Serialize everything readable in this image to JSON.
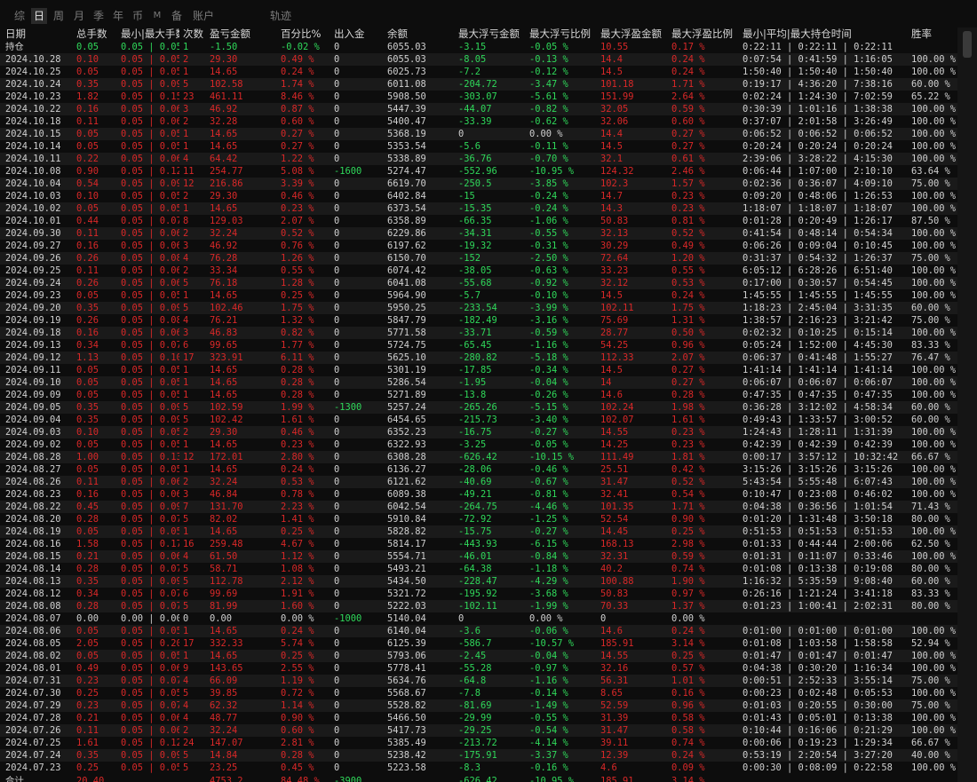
{
  "tabs": [
    "综",
    "日",
    "周",
    "月",
    "季",
    "年",
    "币",
    "M",
    "备",
    "账户",
    "轨迹"
  ],
  "active_tab": "日",
  "headers": [
    "日期",
    "总手数",
    "最小|最大手数",
    "次数",
    "盈亏金额",
    "百分比%",
    "出入金",
    "余额",
    "最大浮亏金额",
    "最大浮亏比例",
    "最大浮盈金额",
    "最大浮盈比例",
    "最小|平均|最大持仓时间",
    "胜率"
  ],
  "holding_row": {
    "label": "持仓",
    "lots": "0.05",
    "minmax": "0.05 | 0.05",
    "count": "1",
    "pnl": "-1.50",
    "pct": "-0.02 %",
    "flow": "0",
    "balance": "6055.03",
    "max_dd": "-3.15",
    "max_dd_pct": "-0.05 %",
    "max_fp": "10.55",
    "max_fp_pct": "0.17 %",
    "hold": "0:22:11 | 0:22:11 | 0:22:11",
    "win": ""
  },
  "rows": [
    [
      "2024.10.28",
      "0.10",
      "0.05 | 0.05",
      "2",
      "29.30",
      "0.49 %",
      "0",
      "6055.03",
      "-8.05",
      "-0.13 %",
      "14.4",
      "0.24 %",
      "0:07:54 | 0:41:59 | 1:16:05",
      "100.00 %"
    ],
    [
      "2024.10.25",
      "0.05",
      "0.05 | 0.05",
      "1",
      "14.65",
      "0.24 %",
      "0",
      "6025.73",
      "-7.2",
      "-0.12 %",
      "14.5",
      "0.24 %",
      "1:50:40 | 1:50:40 | 1:50:40",
      "100.00 %"
    ],
    [
      "2024.10.24",
      "0.35",
      "0.05 | 0.09",
      "5",
      "102.58",
      "1.74 %",
      "0",
      "6011.08",
      "-204.72",
      "-3.47 %",
      "101.18",
      "1.71 %",
      "0:19:17 | 4:36:20 | 7:38:16",
      "60.00 %"
    ],
    [
      "2024.10.23",
      "1.82",
      "0.05 | 0.15",
      "23",
      "461.11",
      "8.46 %",
      "0",
      "5908.50",
      "-303.07",
      "-5.61 %",
      "151.99",
      "2.64 %",
      "0:02:24 | 1:24:30 | 7:02:59",
      "65.22 %"
    ],
    [
      "2024.10.22",
      "0.16",
      "0.05 | 0.06",
      "3",
      "46.92",
      "0.87 %",
      "0",
      "5447.39",
      "-44.07",
      "-0.82 %",
      "32.05",
      "0.59 %",
      "0:30:39 | 1:01:16 | 1:38:38",
      "100.00 %"
    ],
    [
      "2024.10.18",
      "0.11",
      "0.05 | 0.06",
      "2",
      "32.28",
      "0.60 %",
      "0",
      "5400.47",
      "-33.39",
      "-0.62 %",
      "32.06",
      "0.60 %",
      "0:37:07 | 2:01:58 | 3:26:49",
      "100.00 %"
    ],
    [
      "2024.10.15",
      "0.05",
      "0.05 | 0.05",
      "1",
      "14.65",
      "0.27 %",
      "0",
      "5368.19",
      "0",
      "0.00 %",
      "14.4",
      "0.27 %",
      "0:06:52 | 0:06:52 | 0:06:52",
      "100.00 %"
    ],
    [
      "2024.10.14",
      "0.05",
      "0.05 | 0.05",
      "1",
      "14.65",
      "0.27 %",
      "0",
      "5353.54",
      "-5.6",
      "-0.11 %",
      "14.5",
      "0.27 %",
      "0:20:24 | 0:20:24 | 0:20:24",
      "100.00 %"
    ],
    [
      "2024.10.11",
      "0.22",
      "0.05 | 0.06",
      "4",
      "64.42",
      "1.22 %",
      "0",
      "5338.89",
      "-36.76",
      "-0.70 %",
      "32.1",
      "0.61 %",
      "2:39:06 | 3:28:22 | 4:15:30",
      "100.00 %"
    ],
    [
      "2024.10.08",
      "0.90",
      "0.05 | 0.12",
      "11",
      "254.77",
      "5.08 %",
      "-1600",
      "5274.47",
      "-552.96",
      "-10.95 %",
      "124.32",
      "2.46 %",
      "0:06:44 | 1:07:00 | 2:10:10",
      "63.64 %"
    ],
    [
      "2024.10.04",
      "0.54",
      "0.05 | 0.09",
      "12",
      "216.86",
      "3.39 %",
      "0",
      "6619.70",
      "-250.5",
      "-3.85 %",
      "102.3",
      "1.57 %",
      "0:02:36 | 0:36:07 | 4:09:10",
      "75.00 %"
    ],
    [
      "2024.10.03",
      "0.10",
      "0.05 | 0.05",
      "2",
      "29.30",
      "0.46 %",
      "0",
      "6402.84",
      "-15",
      "-0.24 %",
      "14.7",
      "0.23 %",
      "0:09:20 | 0:48:06 | 1:26:53",
      "100.00 %"
    ],
    [
      "2024.10.02",
      "0.05",
      "0.05 | 0.05",
      "1",
      "14.65",
      "0.23 %",
      "0",
      "6373.54",
      "-15.35",
      "-0.24 %",
      "14.3",
      "0.23 %",
      "1:18:07 | 1:18:07 | 1:18:07",
      "100.00 %"
    ],
    [
      "2024.10.01",
      "0.44",
      "0.05 | 0.07",
      "8",
      "129.03",
      "2.07 %",
      "0",
      "6358.89",
      "-66.35",
      "-1.06 %",
      "50.83",
      "0.81 %",
      "0:01:28 | 0:20:49 | 1:26:17",
      "87.50 %"
    ],
    [
      "2024.09.30",
      "0.11",
      "0.05 | 0.06",
      "2",
      "32.24",
      "0.52 %",
      "0",
      "6229.86",
      "-34.31",
      "-0.55 %",
      "32.13",
      "0.52 %",
      "0:41:54 | 0:48:14 | 0:54:34",
      "100.00 %"
    ],
    [
      "2024.09.27",
      "0.16",
      "0.05 | 0.06",
      "3",
      "46.92",
      "0.76 %",
      "0",
      "6197.62",
      "-19.32",
      "-0.31 %",
      "30.29",
      "0.49 %",
      "0:06:26 | 0:09:04 | 0:10:45",
      "100.00 %"
    ],
    [
      "2024.09.26",
      "0.26",
      "0.05 | 0.08",
      "4",
      "76.28",
      "1.26 %",
      "0",
      "6150.70",
      "-152",
      "-2.50 %",
      "72.64",
      "1.20 %",
      "0:31:37 | 0:54:32 | 1:26:37",
      "75.00 %"
    ],
    [
      "2024.09.25",
      "0.11",
      "0.05 | 0.06",
      "2",
      "33.34",
      "0.55 %",
      "0",
      "6074.42",
      "-38.05",
      "-0.63 %",
      "33.23",
      "0.55 %",
      "6:05:12 | 6:28:26 | 6:51:40",
      "100.00 %"
    ],
    [
      "2024.09.24",
      "0.26",
      "0.05 | 0.06",
      "5",
      "76.18",
      "1.28 %",
      "0",
      "6041.08",
      "-55.68",
      "-0.92 %",
      "32.12",
      "0.53 %",
      "0:17:00 | 0:30:57 | 0:54:45",
      "100.00 %"
    ],
    [
      "2024.09.23",
      "0.05",
      "0.05 | 0.05",
      "1",
      "14.65",
      "0.25 %",
      "0",
      "5964.90",
      "-5.7",
      "-0.10 %",
      "14.5",
      "0.24 %",
      "1:45:55 | 1:45:55 | 1:45:55",
      "100.00 %"
    ],
    [
      "2024.09.20",
      "0.35",
      "0.05 | 0.09",
      "5",
      "102.46",
      "1.75 %",
      "0",
      "5950.25",
      "-233.54",
      "-3.99 %",
      "102.11",
      "1.75 %",
      "1:18:23 | 2:45:04 | 3:31:35",
      "60.00 %"
    ],
    [
      "2024.09.19",
      "0.26",
      "0.05 | 0.08",
      "4",
      "76.21",
      "1.32 %",
      "0",
      "5847.79",
      "-182.49",
      "-3.16 %",
      "75.69",
      "1.31 %",
      "1:38:57 | 2:16:23 | 3:21:42",
      "75.00 %"
    ],
    [
      "2024.09.18",
      "0.16",
      "0.05 | 0.06",
      "3",
      "46.83",
      "0.82 %",
      "0",
      "5771.58",
      "-33.71",
      "-0.59 %",
      "28.77",
      "0.50 %",
      "0:02:32 | 0:10:25 | 0:15:14",
      "100.00 %"
    ],
    [
      "2024.09.13",
      "0.34",
      "0.05 | 0.07",
      "6",
      "99.65",
      "1.77 %",
      "0",
      "5724.75",
      "-65.45",
      "-1.16 %",
      "54.25",
      "0.96 %",
      "0:05:24 | 1:52:00 | 4:45:30",
      "83.33 %"
    ],
    [
      "2024.09.12",
      "1.13",
      "0.05 | 0.10",
      "17",
      "323.91",
      "6.11 %",
      "0",
      "5625.10",
      "-280.82",
      "-5.18 %",
      "112.33",
      "2.07 %",
      "0:06:37 | 0:41:48 | 1:55:27",
      "76.47 %"
    ],
    [
      "2024.09.11",
      "0.05",
      "0.05 | 0.05",
      "1",
      "14.65",
      "0.28 %",
      "0",
      "5301.19",
      "-17.85",
      "-0.34 %",
      "14.5",
      "0.27 %",
      "1:41:14 | 1:41:14 | 1:41:14",
      "100.00 %"
    ],
    [
      "2024.09.10",
      "0.05",
      "0.05 | 0.05",
      "1",
      "14.65",
      "0.28 %",
      "0",
      "5286.54",
      "-1.95",
      "-0.04 %",
      "14",
      "0.27 %",
      "0:06:07 | 0:06:07 | 0:06:07",
      "100.00 %"
    ],
    [
      "2024.09.09",
      "0.05",
      "0.05 | 0.05",
      "1",
      "14.65",
      "0.28 %",
      "0",
      "5271.89",
      "-13.8",
      "-0.26 %",
      "14.6",
      "0.28 %",
      "0:47:35 | 0:47:35 | 0:47:35",
      "100.00 %"
    ],
    [
      "2024.09.05",
      "0.35",
      "0.05 | 0.09",
      "5",
      "102.59",
      "1.99 %",
      "-1300",
      "5257.24",
      "-265.26",
      "-5.15 %",
      "102.24",
      "1.98 %",
      "0:36:28 | 3:12:02 | 4:58:34",
      "60.00 %"
    ],
    [
      "2024.09.04",
      "0.35",
      "0.05 | 0.09",
      "5",
      "102.42",
      "1.61 %",
      "0",
      "6454.65",
      "-215.73",
      "-3.40 %",
      "102.07",
      "1.61 %",
      "0:49:43 | 1:33:57 | 3:00:52",
      "60.00 %"
    ],
    [
      "2024.09.03",
      "0.10",
      "0.05 | 0.05",
      "2",
      "29.30",
      "0.46 %",
      "0",
      "6352.23",
      "-16.75",
      "-0.27 %",
      "14.55",
      "0.23 %",
      "1:24:43 | 1:28:11 | 1:31:39",
      "100.00 %"
    ],
    [
      "2024.09.02",
      "0.05",
      "0.05 | 0.05",
      "1",
      "14.65",
      "0.23 %",
      "0",
      "6322.93",
      "-3.25",
      "-0.05 %",
      "14.25",
      "0.23 %",
      "0:42:39 | 0:42:39 | 0:42:39",
      "100.00 %"
    ],
    [
      "2024.08.28",
      "1.00",
      "0.05 | 0.13",
      "12",
      "172.01",
      "2.80 %",
      "0",
      "6308.28",
      "-626.42",
      "-10.15 %",
      "111.49",
      "1.81 %",
      "0:00:17 | 3:57:12 | 10:32:42",
      "66.67 %"
    ],
    [
      "2024.08.27",
      "0.05",
      "0.05 | 0.05",
      "1",
      "14.65",
      "0.24 %",
      "0",
      "6136.27",
      "-28.06",
      "-0.46 %",
      "25.51",
      "0.42 %",
      "3:15:26 | 3:15:26 | 3:15:26",
      "100.00 %"
    ],
    [
      "2024.08.26",
      "0.11",
      "0.05 | 0.06",
      "2",
      "32.24",
      "0.53 %",
      "0",
      "6121.62",
      "-40.69",
      "-0.67 %",
      "31.47",
      "0.52 %",
      "5:43:54 | 5:55:48 | 6:07:43",
      "100.00 %"
    ],
    [
      "2024.08.23",
      "0.16",
      "0.05 | 0.06",
      "3",
      "46.84",
      "0.78 %",
      "0",
      "6089.38",
      "-49.21",
      "-0.81 %",
      "32.41",
      "0.54 %",
      "0:10:47 | 0:23:08 | 0:46:02",
      "100.00 %"
    ],
    [
      "2024.08.22",
      "0.45",
      "0.05 | 0.09",
      "7",
      "131.70",
      "2.23 %",
      "0",
      "6042.54",
      "-264.75",
      "-4.46 %",
      "101.35",
      "1.71 %",
      "0:04:38 | 0:36:56 | 1:01:54",
      "71.43 %"
    ],
    [
      "2024.08.20",
      "0.28",
      "0.05 | 0.07",
      "5",
      "82.02",
      "1.41 %",
      "0",
      "5910.84",
      "-72.92",
      "-1.25 %",
      "52.54",
      "0.90 %",
      "0:01:20 | 1:31:48 | 3:50:18",
      "80.00 %"
    ],
    [
      "2024.08.19",
      "0.05",
      "0.05 | 0.05",
      "1",
      "14.65",
      "0.25 %",
      "0",
      "5828.82",
      "-15.75",
      "-0.27 %",
      "14.45",
      "0.25 %",
      "0:51:53 | 0:51:53 | 0:51:53",
      "100.00 %"
    ],
    [
      "2024.08.16",
      "1.58",
      "0.05 | 0.17",
      "16",
      "259.48",
      "4.67 %",
      "0",
      "5814.17",
      "-443.93",
      "-6.15 %",
      "168.13",
      "2.98 %",
      "0:01:33 | 0:44:44 | 2:00:06",
      "62.50 %"
    ],
    [
      "2024.08.15",
      "0.21",
      "0.05 | 0.06",
      "4",
      "61.50",
      "1.12 %",
      "0",
      "5554.71",
      "-46.01",
      "-0.84 %",
      "32.31",
      "0.59 %",
      "0:01:31 | 0:11:07 | 0:33:46",
      "100.00 %"
    ],
    [
      "2024.08.14",
      "0.28",
      "0.05 | 0.07",
      "5",
      "58.71",
      "1.08 %",
      "0",
      "5493.21",
      "-64.38",
      "-1.18 %",
      "40.2",
      "0.74 %",
      "0:01:08 | 0:13:38 | 0:19:08",
      "80.00 %"
    ],
    [
      "2024.08.13",
      "0.35",
      "0.05 | 0.09",
      "5",
      "112.78",
      "2.12 %",
      "0",
      "5434.50",
      "-228.47",
      "-4.29 %",
      "100.88",
      "1.90 %",
      "1:16:32 | 5:35:59 | 9:08:40",
      "60.00 %"
    ],
    [
      "2024.08.12",
      "0.34",
      "0.05 | 0.07",
      "6",
      "99.69",
      "1.91 %",
      "0",
      "5321.72",
      "-195.92",
      "-3.68 %",
      "50.83",
      "0.97 %",
      "0:26:16 | 1:21:24 | 3:41:18",
      "83.33 %"
    ],
    [
      "2024.08.08",
      "0.28",
      "0.05 | 0.07",
      "5",
      "81.99",
      "1.60 %",
      "0",
      "5222.03",
      "-102.11",
      "-1.99 %",
      "70.33",
      "1.37 %",
      "0:01:23 | 1:00:41 | 2:02:31",
      "80.00 %"
    ],
    [
      "2024.08.07",
      "0.00",
      "0.00 | 0.00",
      "0",
      "0.00",
      "0.00 %",
      "-1000",
      "5140.04",
      "0",
      "0.00 %",
      "0",
      "0.00 %",
      "",
      ""
    ],
    [
      "2024.08.06",
      "0.05",
      "0.05 | 0.05",
      "1",
      "14.65",
      "0.24 %",
      "0",
      "6140.04",
      "-3.6",
      "-0.06 %",
      "14.6",
      "0.24 %",
      "0:01:00 | 0:01:00 | 0:01:00",
      "100.00 %"
    ],
    [
      "2024.08.05",
      "2.05",
      "0.05 | 0.20",
      "17",
      "332.33",
      "5.74 %",
      "0",
      "6125.39",
      "-586.7",
      "-10.57 %",
      "185.91",
      "3.14 %",
      "0:01:08 | 1:03:58 | 1:58:58",
      "52.94 %"
    ],
    [
      "2024.08.02",
      "0.05",
      "0.05 | 0.05",
      "1",
      "14.65",
      "0.25 %",
      "0",
      "5793.06",
      "-2.45",
      "-0.04 %",
      "14.55",
      "0.25 %",
      "0:01:47 | 0:01:47 | 0:01:47",
      "100.00 %"
    ],
    [
      "2024.08.01",
      "0.49",
      "0.05 | 0.06",
      "9",
      "143.65",
      "2.55 %",
      "0",
      "5778.41",
      "-55.28",
      "-0.97 %",
      "32.16",
      "0.57 %",
      "0:04:38 | 0:30:20 | 1:16:34",
      "100.00 %"
    ],
    [
      "2024.07.31",
      "0.23",
      "0.05 | 0.07",
      "4",
      "66.09",
      "1.19 %",
      "0",
      "5634.76",
      "-64.8",
      "-1.16 %",
      "56.31",
      "1.01 %",
      "0:00:51 | 2:52:33 | 3:55:14",
      "75.00 %"
    ],
    [
      "2024.07.30",
      "0.25",
      "0.05 | 0.05",
      "5",
      "39.85",
      "0.72 %",
      "0",
      "5568.67",
      "-7.8",
      "-0.14 %",
      "8.65",
      "0.16 %",
      "0:00:23 | 0:02:48 | 0:05:53",
      "100.00 %"
    ],
    [
      "2024.07.29",
      "0.23",
      "0.05 | 0.07",
      "4",
      "62.32",
      "1.14 %",
      "0",
      "5528.82",
      "-81.69",
      "-1.49 %",
      "52.59",
      "0.96 %",
      "0:01:03 | 0:20:55 | 0:30:00",
      "75.00 %"
    ],
    [
      "2024.07.28",
      "0.21",
      "0.05 | 0.06",
      "4",
      "48.77",
      "0.90 %",
      "0",
      "5466.50",
      "-29.99",
      "-0.55 %",
      "31.39",
      "0.58 %",
      "0:01:43 | 0:05:01 | 0:13:38",
      "100.00 %"
    ],
    [
      "2024.07.26",
      "0.11",
      "0.05 | 0.06",
      "2",
      "32.24",
      "0.60 %",
      "0",
      "5417.73",
      "-29.25",
      "-0.54 %",
      "31.47",
      "0.58 %",
      "0:10:44 | 0:16:06 | 0:21:29",
      "100.00 %"
    ],
    [
      "2024.07.25",
      "1.61",
      "0.05 | 0.12",
      "24",
      "147.07",
      "2.81 %",
      "0",
      "5385.49",
      "-213.72",
      "-4.14 %",
      "39.11",
      "0.74 %",
      "0:00:06 | 0:19:23 | 1:29:34",
      "66.67 %"
    ],
    [
      "2024.07.24",
      "0.35",
      "0.05 | 0.09",
      "5",
      "14.84",
      "0.28 %",
      "0",
      "5238.42",
      "-175.91",
      "-3.37 %",
      "12.39",
      "0.24 %",
      "0:53:19 | 2:20:54 | 3:27:20",
      "40.00 %"
    ],
    [
      "2024.07.23",
      "0.25",
      "0.05 | 0.05",
      "5",
      "23.25",
      "0.45 %",
      "0",
      "5223.58",
      "-8.3",
      "-0.16 %",
      "4.6",
      "0.09 %",
      "0:00:30 | 0:08:09 | 0:22:58",
      "100.00 %"
    ]
  ],
  "sum_row": {
    "label": "合计",
    "lots": "20.40",
    "pnl": "4753.2",
    "pct": "84.48 %",
    "flow": "-3900",
    "max_dd": "-626.42",
    "max_dd_pct": "-10.95 %",
    "max_fp": "185.91",
    "max_fp_pct": "3.14 %"
  },
  "colors": {
    "positive": "#d92828",
    "negative": "#2fd85a",
    "neutral": "#c8c8c8",
    "background": "#0d0d0d",
    "row_alt": "#1a1a1a"
  }
}
